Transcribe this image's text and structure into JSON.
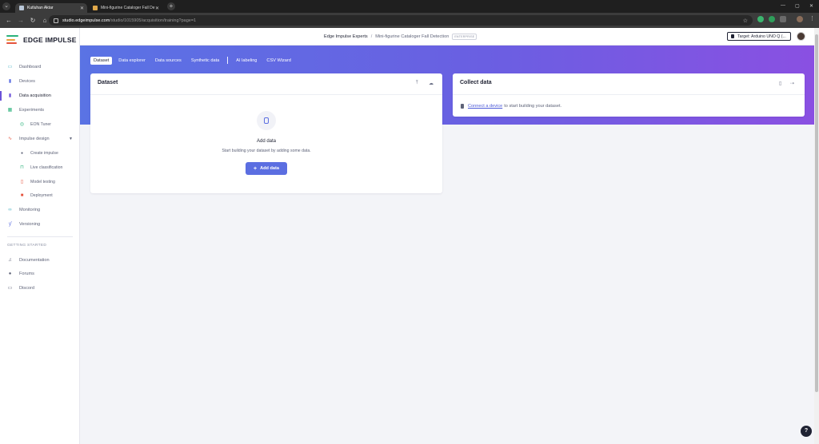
{
  "browser": {
    "tabs": [
      {
        "title": "Kutluhan Aktar",
        "active": true
      },
      {
        "title": "Mini-figurine Cataloger Fall De",
        "active": false
      }
    ],
    "url_host": "studio.edgeimpulse.com",
    "url_path": "/studio/1015905/acquisition/training?page=1"
  },
  "app": {
    "logo_text": "EDGE IMPULSE",
    "brand_colors": [
      "#2ab27b",
      "#e8a33d",
      "#e5533d"
    ],
    "accent_color": "#6b52d8"
  },
  "sidebar": {
    "items": [
      {
        "label": "Dashboard",
        "icon": "monitor-icon"
      },
      {
        "label": "Devices",
        "icon": "device-icon"
      },
      {
        "label": "Data acquisition",
        "icon": "database-icon",
        "active": true
      },
      {
        "label": "Experiments",
        "icon": "table-icon"
      },
      {
        "label": "EON Tuner",
        "icon": "tuner-icon"
      },
      {
        "label": "Impulse design",
        "icon": "impulse-icon"
      },
      {
        "label": "Create impulse",
        "icon": "dot-icon"
      },
      {
        "label": "Live classification",
        "icon": "classification-icon"
      },
      {
        "label": "Model testing",
        "icon": "test-icon"
      },
      {
        "label": "Deployment",
        "icon": "deploy-icon"
      },
      {
        "label": "Monitoring",
        "icon": "binoculars-icon"
      },
      {
        "label": "Versioning",
        "icon": "branch-icon"
      }
    ],
    "section_title": "GETTING STARTED",
    "getting_started": [
      {
        "label": "Documentation",
        "icon": "docs-icon"
      },
      {
        "label": "Forums",
        "icon": "forums-icon"
      },
      {
        "label": "Discord",
        "icon": "discord-icon"
      }
    ]
  },
  "header": {
    "org": "Edge Impulse Experts",
    "separator": "/",
    "project": "Mini-figurine Cataloger Fall Detection",
    "badge": "ENTERPRISE",
    "target_label": "Target: Arduino UNO Q (..."
  },
  "page_tabs": [
    "Dataset",
    "Data explorer",
    "Data sources",
    "Synthetic data",
    "AI labeling",
    "CSV Wizard"
  ],
  "dataset_card": {
    "title": "Dataset",
    "empty_title": "Add data",
    "empty_desc": "Start building your dataset by adding some data.",
    "add_button": "Add data"
  },
  "collect_card": {
    "title": "Collect data",
    "link_text": "Connect a device",
    "rest_text": "to start building your dataset."
  }
}
